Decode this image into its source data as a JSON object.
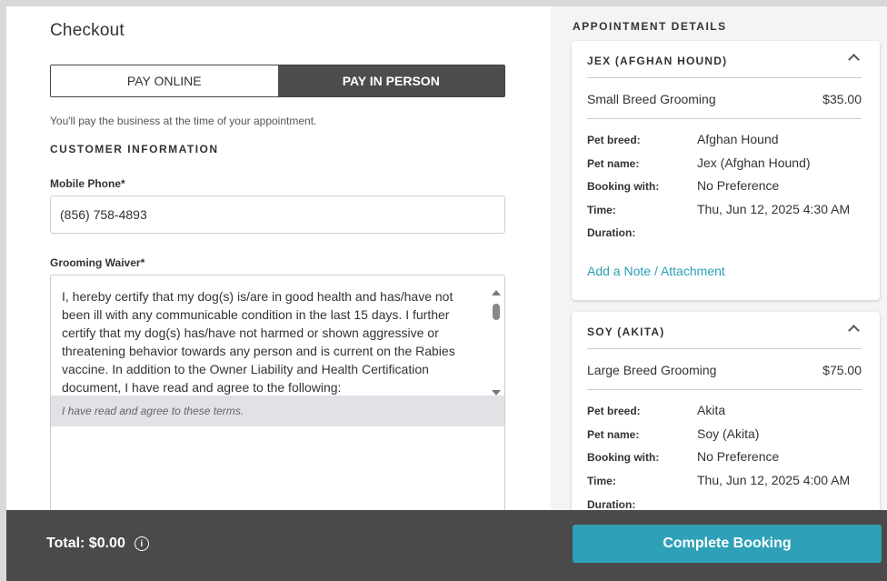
{
  "checkout": {
    "title": "Checkout",
    "pay_options": [
      "PAY ONLINE",
      "PAY IN PERSON"
    ],
    "selected_pay_option": "PAY IN PERSON",
    "pay_note": "You'll pay the business at the time of your appointment.",
    "customer_heading": "CUSTOMER INFORMATION",
    "phone_label": "Mobile Phone*",
    "phone_value": "(856) 758-4893",
    "waiver_label": "Grooming Waiver*",
    "waiver_text": "I, hereby certify that my dog(s) is/are in good health and has/have not been ill with any communicable condition in the last 15 days. I further certify that my dog(s) has/have not harmed or shown aggressive or threatening behavior towards any person and is current on the Rabies vaccine. In addition to the Owner Liability and Health Certification document, I have read and agree to the following:",
    "waiver_agree": "I have read and agree to these terms."
  },
  "appointments": {
    "heading": "APPOINTMENT DETAILS",
    "labels": {
      "breed": "Pet breed:",
      "name": "Pet name:",
      "booking": "Booking with:",
      "time": "Time:",
      "duration": "Duration:"
    },
    "cards": [
      {
        "title": "JEX (AFGHAN HOUND)",
        "service": "Small Breed Grooming",
        "price": "$35.00",
        "breed": "Afghan Hound",
        "name": "Jex (Afghan Hound)",
        "booking": "No Preference",
        "time": "Thu, Jun 12, 2025 4:30 AM",
        "duration": "",
        "note_link": "Add a Note / Attachment"
      },
      {
        "title": "SOY (AKITA)",
        "service": "Large Breed Grooming",
        "price": "$75.00",
        "breed": "Akita",
        "name": "Soy (Akita)",
        "booking": "No Preference",
        "time": "Thu, Jun 12, 2025 4:00 AM",
        "duration": ""
      }
    ]
  },
  "footer": {
    "total": "Total: $0.00",
    "complete_button": "Complete Booking"
  },
  "colors": {
    "accent": "#2ea1b8",
    "footer_bg": "#4a4a4a",
    "toggle_selected": "#4d4d4d"
  }
}
